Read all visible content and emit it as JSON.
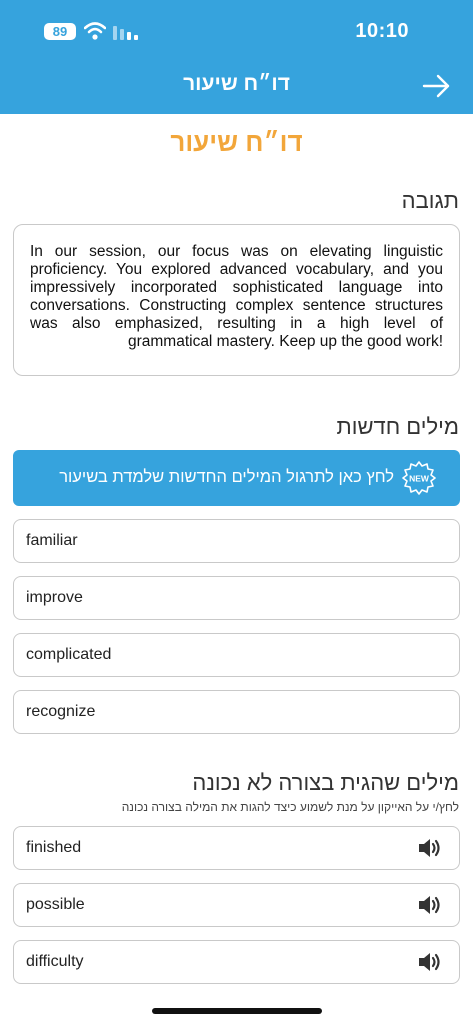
{
  "status_bar": {
    "battery": "89",
    "time": "10:10"
  },
  "header": {
    "title": "דו״ח שיעור",
    "back_icon": "arrow-right-icon"
  },
  "page_title": "דו״ח שיעור",
  "feedback": {
    "title": "תגובה",
    "text": "In our session, our focus was on elevating linguistic proficiency. You explored advanced vocabulary, and you impressively incorporated sophisticated language into conversations. Constructing complex sentence structures was also emphasized, resulting in a high level of grammatical mastery. Keep up the good work!"
  },
  "new_words": {
    "title": "מילים חדשות",
    "practice_label": "לחץ כאן לתרגול המילים החדשות שלמדת בשיעור",
    "badge_text": "NEW",
    "words": [
      "familiar",
      "improve",
      "complicated",
      "recognize"
    ]
  },
  "mispronounced": {
    "title": "מילים שהגית בצורה לא נכונה",
    "instruction": "לחץ/י על האייקון על מנת לשמוע כיצד להגות את המילה בצורה נכונה",
    "speaker_icon": "speaker-icon",
    "words": [
      "finished",
      "possible",
      "difficulty"
    ]
  },
  "colors": {
    "primary": "#36A3DD",
    "accent": "#F2A63A",
    "border": "#C9C9C9"
  }
}
